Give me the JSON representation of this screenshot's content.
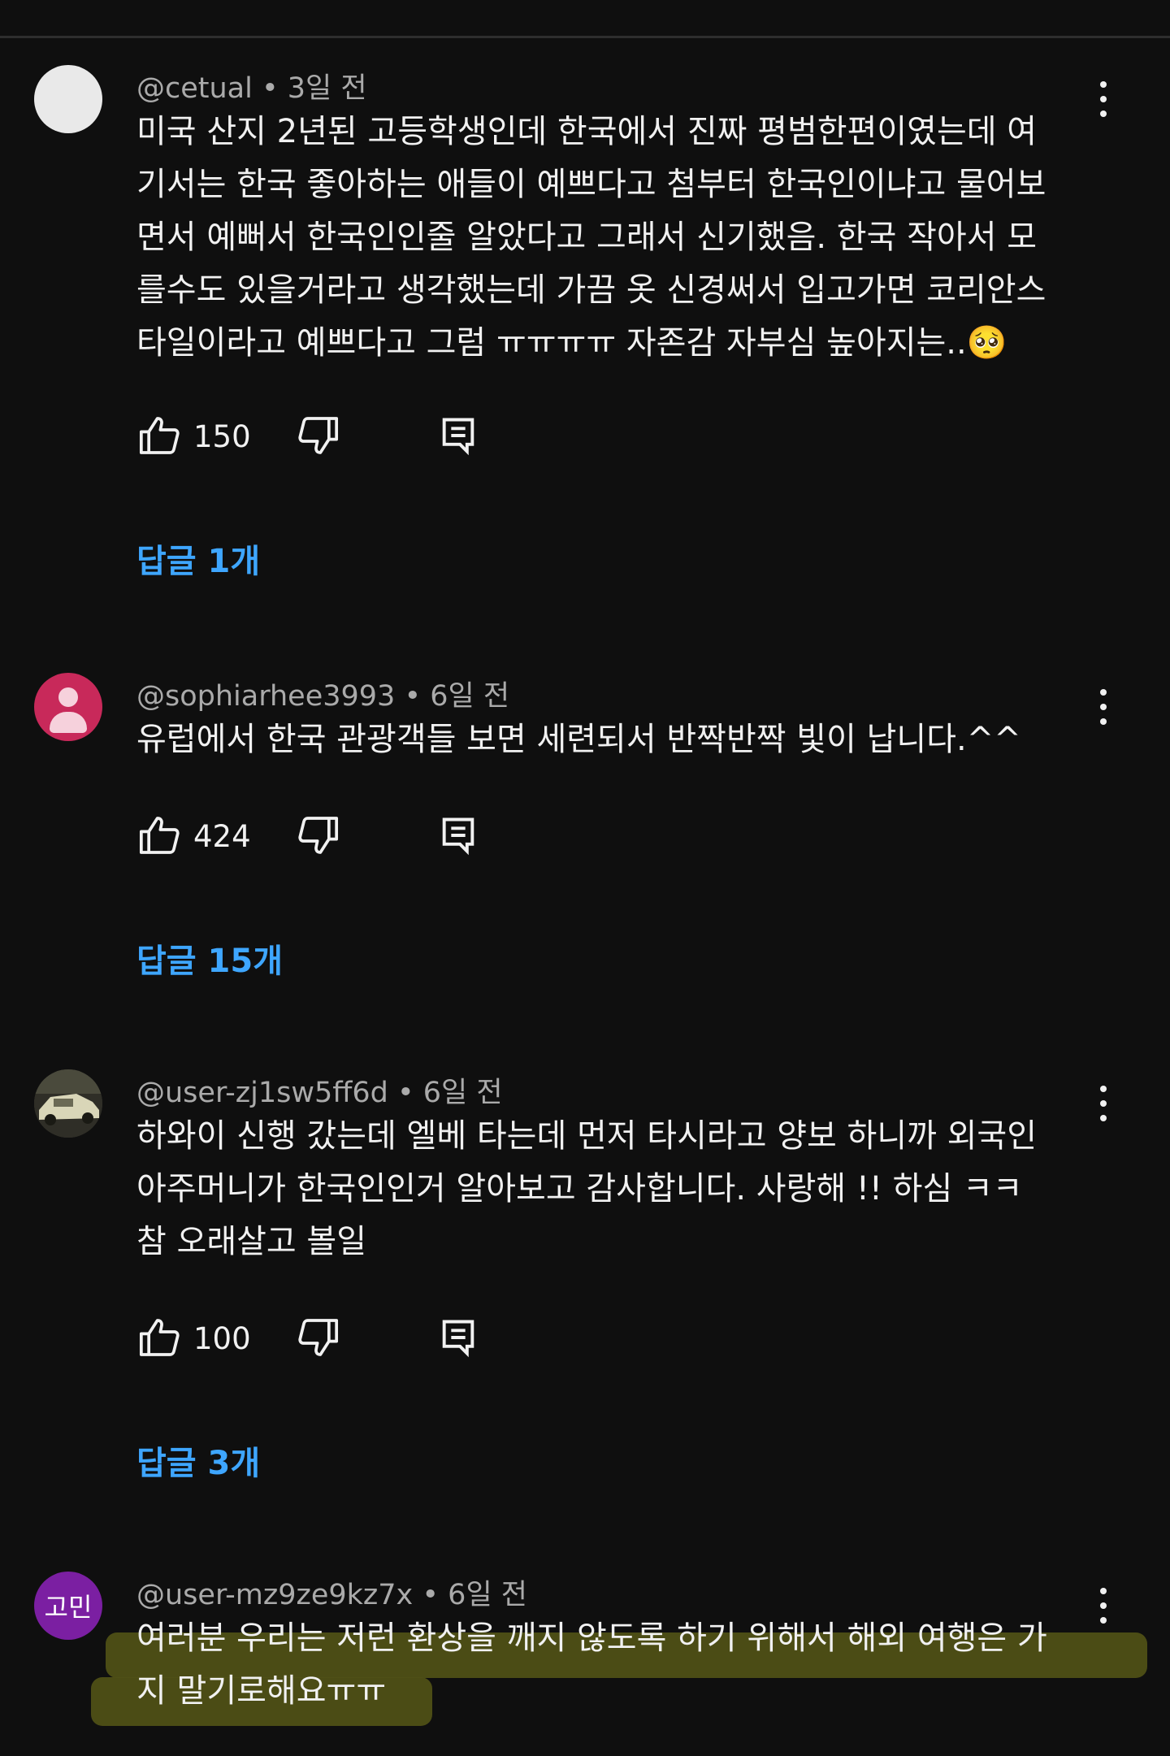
{
  "comments": [
    {
      "author": "@cetual",
      "time": "3일 전",
      "text": "미국 산지 2년된 고등학생인데 한국에서 진짜 평범한편이였는데 여\n기서는 한국 좋아하는 애들이 예쁘다고 첨부터 한국인이냐고 물어보\n면서 예뻐서 한국인인줄 알았다고 그래서 신기했음. 한국 작아서 모\n를수도 있을거라고 생각했는데 가끔 옷 신경써서 입고가면 코리안스\n타일이라고 예쁘다고 그럼 ㅠㅠㅠㅠ 자존감 자부심 높아지는..🥺",
      "likes": "150",
      "replies": "답글 1개"
    },
    {
      "author": "@sophiarhee3993",
      "time": "6일 전",
      "text": "유럽에서 한국 관광객들 보면 세련되서 반짝반짝 빛이 납니다.^^",
      "likes": "424",
      "replies": "답글 15개"
    },
    {
      "author": "@user-zj1sw5ff6d",
      "time": "6일 전",
      "text": "하와이 신행 갔는데 엘베 타는데 먼저 타시라고 양보 하니까 외국인\n아주머니가 한국인인거 알아보고 감사합니다. 사랑해 !! 하심 ㅋㅋ\n참 오래살고 볼일",
      "likes": "100",
      "replies": "답글 3개"
    },
    {
      "author": "@user-mz9ze9kz7x",
      "time": "6일 전",
      "avatar_text": "고민",
      "text": "여러분 우리는 저런 환상을 깨지 않도록 하기 위해서 해외 여행은 가\n지 말기로해요ㅠㅠ"
    }
  ],
  "separator": " • ",
  "colors": {
    "background": "#0f0f0f",
    "link": "#3ea6ff",
    "secondary": "#aaaaaa",
    "highlight": "#4f5016"
  }
}
